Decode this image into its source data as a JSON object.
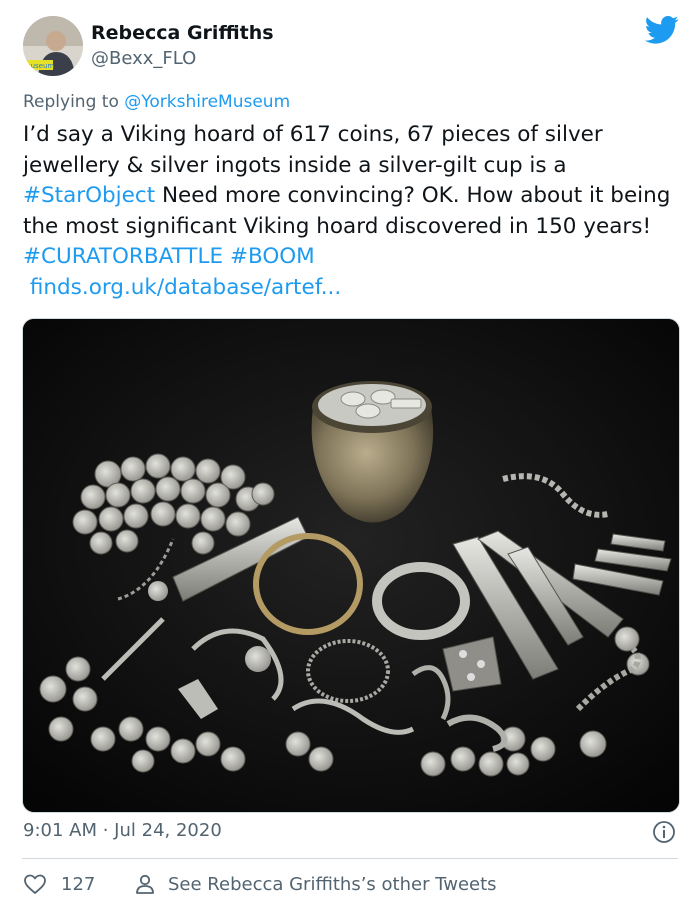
{
  "author": {
    "name": "Rebecca Griffiths",
    "handle": "@Bexx_FLO",
    "avatar_badge": "museum"
  },
  "reply": {
    "prefix": "Replying to ",
    "to": "@YorkshireMuseum"
  },
  "tweet": {
    "t1": "I’d say a Viking hoard of 617 coins, 67 pieces of silver jewellery & silver ingots inside a silver-gilt cup is a ",
    "tag1": "#StarObject",
    "t2": " Need more convincing? OK. How about it being the most significant Viking hoard discovered in 150 years! ",
    "tag2": "#CURATORBATTLE",
    "tag3": "#BOOM",
    "link": "finds.org.uk/database/artef..."
  },
  "meta": {
    "time": "9:01 AM",
    "sep": " · ",
    "date": "Jul 24, 2020"
  },
  "actions": {
    "likes": "127",
    "other_tweets": "See Rebecca Griffiths’s other Tweets"
  },
  "colors": {
    "link": "#1d9bf0",
    "text": "#0f1419",
    "muted": "#536471",
    "border": "#cfd9de"
  },
  "icons": [
    "twitter-bird-icon",
    "info-icon",
    "heart-icon",
    "person-icon"
  ]
}
